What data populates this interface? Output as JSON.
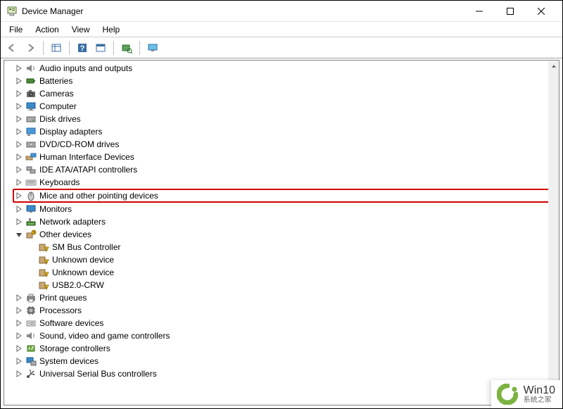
{
  "window": {
    "title": "Device Manager"
  },
  "menu": {
    "file": "File",
    "action": "Action",
    "view": "View",
    "help": "Help"
  },
  "tree": {
    "items": [
      {
        "label": "Audio inputs and outputs"
      },
      {
        "label": "Batteries"
      },
      {
        "label": "Cameras"
      },
      {
        "label": "Computer"
      },
      {
        "label": "Disk drives"
      },
      {
        "label": "Display adapters"
      },
      {
        "label": "DVD/CD-ROM drives"
      },
      {
        "label": "Human Interface Devices"
      },
      {
        "label": "IDE ATA/ATAPI controllers"
      },
      {
        "label": "Keyboards"
      },
      {
        "label": "Mice and other pointing devices"
      },
      {
        "label": "Monitors"
      },
      {
        "label": "Network adapters"
      },
      {
        "label": "Other devices"
      },
      {
        "label": "Print queues"
      },
      {
        "label": "Processors"
      },
      {
        "label": "Software devices"
      },
      {
        "label": "Sound, video and game controllers"
      },
      {
        "label": "Storage controllers"
      },
      {
        "label": "System devices"
      },
      {
        "label": "Universal Serial Bus controllers"
      }
    ],
    "other_children": [
      {
        "label": "SM Bus Controller"
      },
      {
        "label": "Unknown device"
      },
      {
        "label": "Unknown device"
      },
      {
        "label": "USB2.0-CRW"
      }
    ]
  },
  "watermark": {
    "big": "Win10",
    "small": "系统之家"
  }
}
